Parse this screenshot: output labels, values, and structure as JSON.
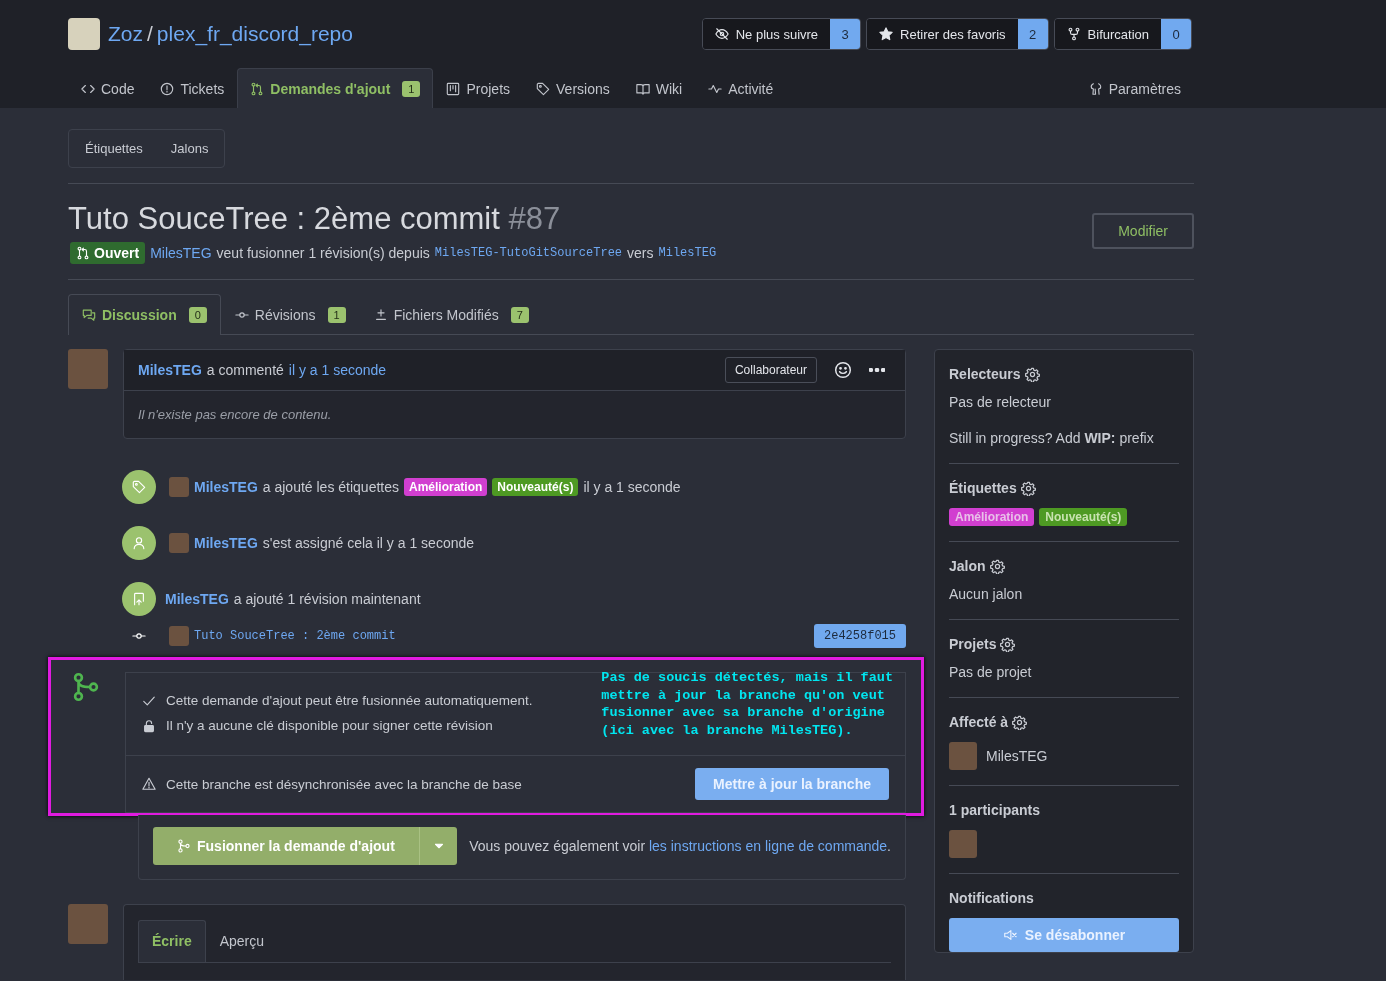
{
  "repo": {
    "owner": "Zoz",
    "separator": "/",
    "name": "plex_fr_discord_repo"
  },
  "repo_buttons": [
    {
      "kind": "watch",
      "label": "Ne plus suivre",
      "count": "3"
    },
    {
      "kind": "star",
      "label": "Retirer des favoris",
      "count": "2"
    },
    {
      "kind": "fork",
      "label": "Bifurcation",
      "count": "0"
    }
  ],
  "nav_tabs": [
    {
      "kind": "code",
      "label": "Code",
      "selected": false
    },
    {
      "kind": "issues",
      "label": "Tickets",
      "selected": false
    },
    {
      "kind": "pulls",
      "label": "Demandes d'ajout",
      "count": "1",
      "selected": true
    },
    {
      "kind": "projects",
      "label": "Projets",
      "selected": false
    },
    {
      "kind": "tag",
      "label": "Versions",
      "selected": false
    },
    {
      "kind": "wiki",
      "label": "Wiki",
      "selected": false
    },
    {
      "kind": "activity",
      "label": "Activité",
      "selected": false
    }
  ],
  "settings_tab": {
    "label": "Paramètres"
  },
  "sub_tabs": [
    "Étiquettes",
    "Jalons"
  ],
  "pr": {
    "title": "Tuto SouceTree : 2ème commit",
    "number": "#87",
    "status": "Ouvert",
    "author": "MilesTEG",
    "text": "veut fusionner 1 révision(s) depuis",
    "head_branch": "MilesTEG-TutoGitSourceTree",
    "between": "vers",
    "base_branch": "MilesTEG"
  },
  "edit_button": "Modifier",
  "pr_tabs": [
    {
      "kind": "discussion",
      "label": "Discussion",
      "count": "0",
      "selected": true
    },
    {
      "kind": "commits",
      "label": "Révisions",
      "count": "1",
      "selected": false
    },
    {
      "kind": "files",
      "label": "Fichiers Modifiés",
      "count": "7",
      "selected": false
    }
  ],
  "comment": {
    "author": "MilesTEG",
    "action": "a commenté",
    "time": "il y a 1 seconde",
    "role": "Collaborateur",
    "body": "Il n'existe pas encore de contenu."
  },
  "events": [
    {
      "kind": "label",
      "author": "MilesTEG",
      "text": "a ajouté les étiquettes",
      "labels": [
        {
          "name": "Amélioration",
          "color": "#d13fd0"
        },
        {
          "name": "Nouveauté(s)",
          "color": "#4e9a23"
        }
      ],
      "time": "il y a 1 seconde"
    },
    {
      "kind": "assign",
      "author": "MilesTEG",
      "text": "s'est assigné cela il y a 1 seconde"
    },
    {
      "kind": "push",
      "author": "MilesTEG",
      "text": "a ajouté 1 révision maintenant"
    },
    {
      "kind": "commit",
      "message": "Tuto SouceTree : 2ème commit",
      "sha": "2e4258f015"
    }
  ],
  "merge": {
    "checks": [
      {
        "kind": "ok",
        "text": "Cette demande d'ajout peut être fusionnée automatiquement."
      },
      {
        "kind": "unlocked",
        "text": "Il n'y a aucune clé disponible pour signer cette révision"
      }
    ],
    "warning": "Cette branche est désynchronisée avec la branche de base",
    "update_button": "Mettre à jour la branche",
    "merge_button": "Fusionner la demande d'ajout",
    "note": "Vous pouvez également voir",
    "note_link": "les instructions en ligne de commande",
    "note_end": "."
  },
  "annotation": {
    "lines": [
      "Pas de soucis détectés, mais il faut",
      "mettre à jour la branche qu'on veut",
      "fusionner avec sa branche d'origine",
      "(ici avec la branche MilesTEG)."
    ]
  },
  "editor_tabs": [
    {
      "label": "Écrire",
      "selected": true
    },
    {
      "label": "Aperçu",
      "selected": false
    }
  ],
  "sidebar": [
    {
      "kind": "text",
      "title": "Relecteurs",
      "gear": true,
      "lines": [
        "Pas de relecteur",
        "Still in progress? Add **WIP:** prefix"
      ]
    },
    {
      "kind": "labels",
      "title": "Étiquettes",
      "gear": true,
      "labels": [
        {
          "name": "Amélioration",
          "color": "#d13fd0"
        },
        {
          "name": "Nouveauté(s)",
          "color": "#4e9a23"
        }
      ]
    },
    {
      "kind": "text",
      "title": "Jalon",
      "gear": true,
      "lines": [
        "Aucun jalon"
      ]
    },
    {
      "kind": "text",
      "title": "Projets",
      "gear": true,
      "lines": [
        "Pas de projet"
      ]
    },
    {
      "kind": "user",
      "title": "Affecté à",
      "gear": true,
      "user": "MilesTEG"
    },
    {
      "kind": "avatars",
      "title": "1 participants",
      "gear": false
    },
    {
      "kind": "button",
      "title": "Notifications",
      "gear": false,
      "button": "Se désabonner"
    }
  ]
}
